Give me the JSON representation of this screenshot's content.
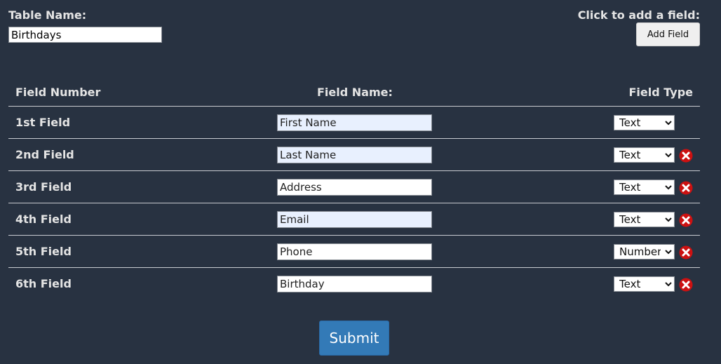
{
  "header": {
    "table_name_label": "Table Name:",
    "table_name_value": "Birthdays",
    "add_label": "Click to add a field:",
    "add_button_label": "Add Field"
  },
  "table": {
    "col_number": "Field Number",
    "col_name": "Field Name:",
    "col_type": "Field Type",
    "rows": [
      {
        "label": "1st Field",
        "name": "First Name",
        "type": "Text",
        "deletable": false
      },
      {
        "label": "2nd Field",
        "name": "Last Name",
        "type": "Text",
        "deletable": true
      },
      {
        "label": "3rd Field",
        "name": "Address",
        "type": "Text",
        "deletable": true
      },
      {
        "label": "4th Field",
        "name": "Email",
        "type": "Text",
        "deletable": true
      },
      {
        "label": "5th Field",
        "name": "Phone",
        "type": "Number",
        "deletable": true
      },
      {
        "label": "6th Field",
        "name": "Birthday",
        "type": "Text",
        "deletable": true
      }
    ]
  },
  "submit_label": "Submit",
  "colors": {
    "background": "#283241",
    "submit": "#337ab7",
    "delete": "#cc1111"
  },
  "icons": {
    "delete": "delete-icon"
  }
}
